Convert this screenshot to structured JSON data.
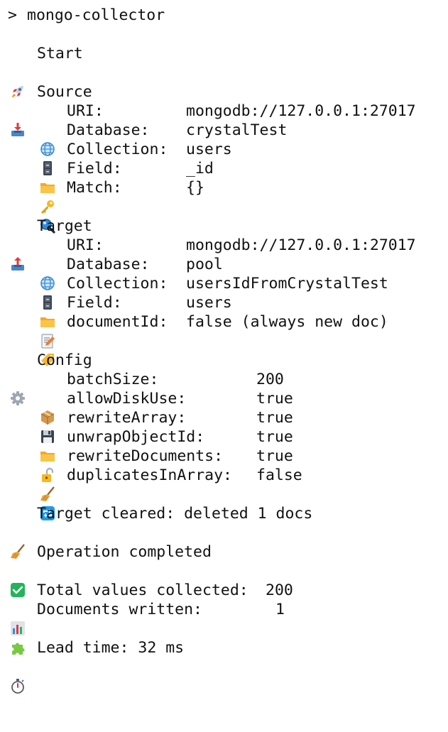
{
  "prompt": {
    "symbol": ">",
    "command": "mongo-collector"
  },
  "start": {
    "icon": "rocket-icon",
    "label": "Start"
  },
  "source": {
    "icon": "inbox-tray-icon",
    "title": "Source",
    "rows": [
      {
        "icon": "globe-icon",
        "key": "URI:",
        "value": "mongodb://127.0.0.1:27017"
      },
      {
        "icon": "file-cabinet-icon",
        "key": "Database:",
        "value": "crystalTest"
      },
      {
        "icon": "folder-icon",
        "key": "Collection:",
        "value": "users"
      },
      {
        "icon": "key-icon",
        "key": "Field:",
        "value": "_id"
      },
      {
        "icon": "magnifier-icon",
        "key": "Match:",
        "value": "{}"
      }
    ]
  },
  "target": {
    "icon": "outbox-tray-icon",
    "title": "Target",
    "rows": [
      {
        "icon": "globe-icon",
        "key": "URI:",
        "value": "mongodb://127.0.0.1:27017"
      },
      {
        "icon": "file-cabinet-icon",
        "key": "Database:",
        "value": "pool"
      },
      {
        "icon": "folder-icon",
        "key": "Collection:",
        "value": "usersIdFromCrystalTest"
      },
      {
        "icon": "memo-icon",
        "key": "Field:",
        "value": "users"
      },
      {
        "icon": "label-tag-icon",
        "key": "documentId:",
        "value": "false (always new doc)"
      }
    ]
  },
  "config": {
    "icon": "gear-icon",
    "title": "Config",
    "rows": [
      {
        "icon": "package-icon",
        "key": "batchSize:",
        "value": "200"
      },
      {
        "icon": "floppy-disk-icon",
        "key": "allowDiskUse:",
        "value": "true"
      },
      {
        "icon": "folder-icon",
        "key": "rewriteArray:",
        "value": "true"
      },
      {
        "icon": "unlocked-icon",
        "key": "unwrapObjectId:",
        "value": "true"
      },
      {
        "icon": "broom-icon",
        "key": "rewriteDocuments:",
        "value": "true"
      },
      {
        "icon": "repeat-icon",
        "key": "duplicatesInArray:",
        "value": "false"
      }
    ]
  },
  "cleared": {
    "icon": "broom-icon",
    "text": "Target cleared: deleted 1 docs"
  },
  "completed": {
    "icon": "check-mark-button-icon",
    "text": "Operation completed"
  },
  "stats": {
    "total": {
      "icon": "bar-chart-icon",
      "key": "Total values collected:",
      "value": "200"
    },
    "written": {
      "icon": "puzzle-piece-icon",
      "key": "Documents written:",
      "value": "1"
    }
  },
  "lead_time": {
    "icon": "stopwatch-icon",
    "text": "Lead time: 32 ms"
  }
}
